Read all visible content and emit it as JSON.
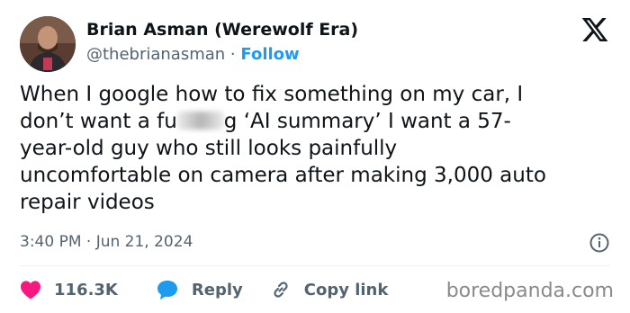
{
  "author": {
    "display_name": "Brian Asman (Werewolf Era)",
    "handle": "@thebrianasman",
    "separator": "·",
    "follow_label": "Follow"
  },
  "tweet": {
    "lines": [
      {
        "pre": "When I google how to fix something on my car, I"
      },
      {
        "pre": "don’t want a fu",
        "post": "g ‘AI summary’ I want a 57-"
      },
      {
        "pre": "year-old guy who still looks painfully"
      },
      {
        "pre": "uncomfortable on camera after making 3,000 auto"
      },
      {
        "pre": "repair videos"
      }
    ],
    "timestamp": "3:40 PM · Jun 21, 2024"
  },
  "actions": {
    "likes": "116.3K",
    "reply_label": "Reply",
    "copy_link_label": "Copy link"
  },
  "icons": {
    "brand": "x-logo-icon",
    "info": "info-icon",
    "like": "heart-icon",
    "reply": "speech-bubble-icon",
    "copy": "link-icon"
  },
  "colors": {
    "accent": "#1d9bf0",
    "like": "#f91880",
    "text": "#0f1419",
    "muted": "#536471"
  },
  "watermark": "boredpanda.com"
}
